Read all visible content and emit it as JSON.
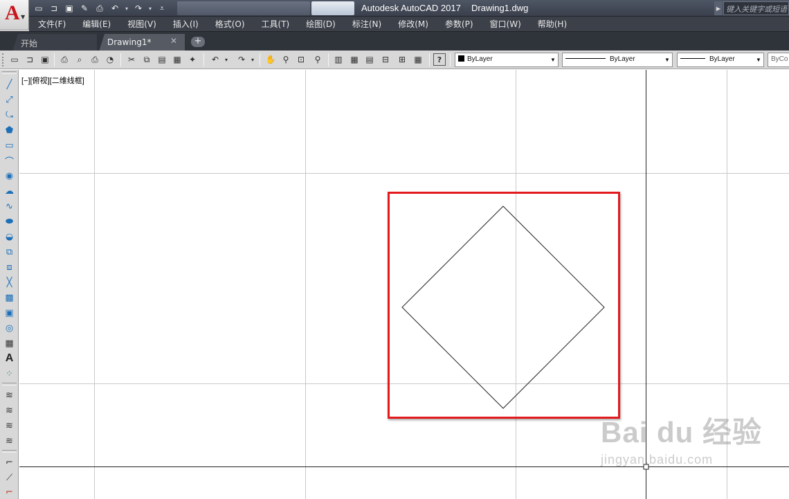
{
  "app": {
    "title": "Autodesk AutoCAD 2017",
    "document": "Drawing1.dwg",
    "logo_letter": "A"
  },
  "search": {
    "placeholder": "键入关键字或短语"
  },
  "menu": [
    "文件(F)",
    "编辑(E)",
    "视图(V)",
    "插入(I)",
    "格式(O)",
    "工具(T)",
    "绘图(D)",
    "标注(N)",
    "修改(M)",
    "参数(P)",
    "窗口(W)",
    "帮助(H)"
  ],
  "tabs": {
    "start": "开始",
    "drawing": "Drawing1*",
    "close": "✕",
    "add": "+"
  },
  "properties": {
    "color": "ByLayer",
    "linetype": "ByLayer",
    "lineweight": "ByLayer",
    "plotstyle": "ByCo"
  },
  "viewport": {
    "label": "[−][俯视][二维线框]"
  },
  "watermark": {
    "main": "Bai du 经验",
    "sub": "jingyan.baidu.com"
  },
  "colors": {
    "highlight": "#e31a1c",
    "title_bar": "#3f4550",
    "menu_bar": "#3c4049",
    "toolbar": "#d8d8d8"
  },
  "icons": {
    "quick_access": [
      "new-icon",
      "open-icon",
      "save-icon",
      "save-as-icon",
      "plot-icon",
      "undo-icon",
      "redo-icon",
      "customize-icon"
    ],
    "standard_toolbar": [
      "new-icon",
      "open-icon",
      "save-icon",
      "plot-icon",
      "plot-preview-icon",
      "publish-icon",
      "3d-print-icon",
      "cut-icon",
      "copy-icon",
      "paste-icon",
      "match-properties-icon",
      "block-editor-icon",
      "undo-icon",
      "redo-icon",
      "pan-icon",
      "zoom-realtime-icon",
      "zoom-window-icon",
      "zoom-previous-icon",
      "properties-icon",
      "design-center-icon",
      "tool-palettes-icon",
      "sheet-set-icon",
      "markup-icon",
      "calculator-icon",
      "help-icon"
    ],
    "draw_toolbar": [
      "line-icon",
      "construction-line-icon",
      "polyline-icon",
      "polygon-icon",
      "rectangle-icon",
      "arc-icon",
      "circle-icon",
      "revision-cloud-icon",
      "spline-icon",
      "ellipse-icon",
      "ellipse-arc-icon",
      "insert-block-icon",
      "make-block-icon",
      "point-icon",
      "hatch-icon",
      "gradient-icon",
      "region-icon",
      "table-icon",
      "multiline-text-icon",
      "add-selected-icon",
      "layer-properties-icon",
      "layer-previous-icon",
      "layer-isolate-icon",
      "layer-unisolate-icon",
      "fillet-icon",
      "chamfer-icon",
      "trim-icon"
    ]
  }
}
